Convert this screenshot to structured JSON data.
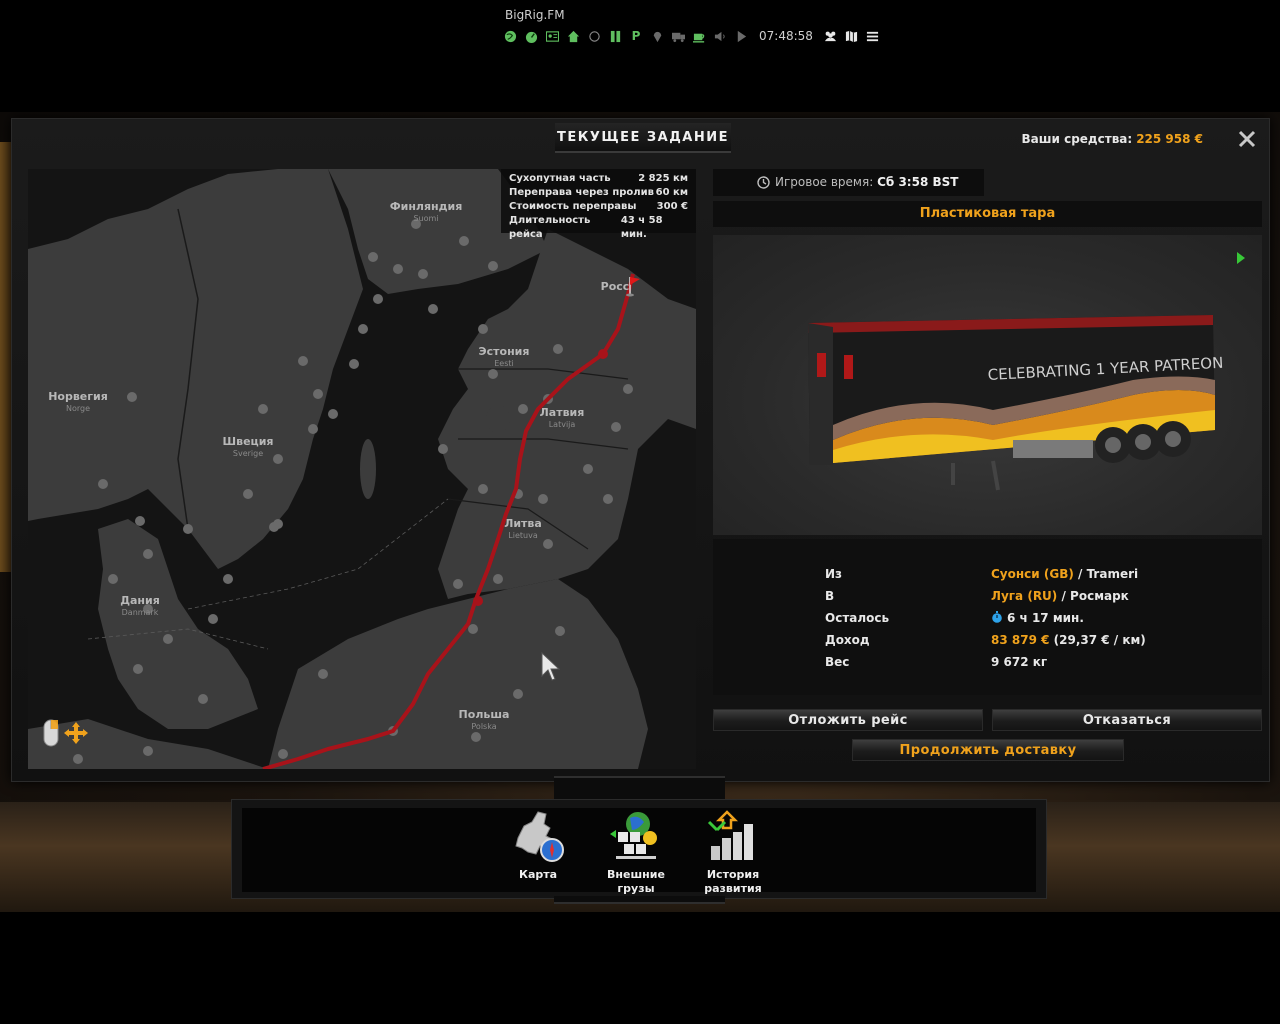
{
  "overlay": {
    "station": "BigRig.FM",
    "time": "07:48:58",
    "parking_label": "P",
    "icons": [
      "globe-icon",
      "speedometer-icon",
      "id-card-icon",
      "home-icon",
      "circle-icon",
      "pause-icon",
      "map-pin-icon",
      "truck-icon",
      "coffee-icon",
      "volume-icon",
      "play-icon",
      "group-icon",
      "map-icon",
      "menu-icon"
    ]
  },
  "window": {
    "title": "ТЕКУЩЕЕ ЗАДАНИЕ",
    "funds_label": "Ваши средства:",
    "funds_value": "225 958 €"
  },
  "route_stats": [
    {
      "label": "Сухопутная часть",
      "value": "2 825 км"
    },
    {
      "label": "Переправа через пролив",
      "value": "60 км"
    },
    {
      "label": "Стоимость переправы",
      "value": "300 €"
    },
    {
      "label": "Длительность рейса",
      "value": "43 ч 58 мин."
    }
  ],
  "map_labels": [
    {
      "ru": "Финляндия",
      "loc": "Suomi"
    },
    {
      "ru": "Росс",
      "loc": ""
    },
    {
      "ru": "Эстония",
      "loc": "Eesti"
    },
    {
      "ru": "Норвегия",
      "loc": "Norge"
    },
    {
      "ru": "Латвия",
      "loc": "Latvija"
    },
    {
      "ru": "Швеция",
      "loc": "Sverige"
    },
    {
      "ru": "Литва",
      "loc": "Lietuva"
    },
    {
      "ru": "Дания",
      "loc": "Danmark"
    },
    {
      "ru": "Польша",
      "loc": "Polska"
    }
  ],
  "job": {
    "game_time_label": "Игровое время:",
    "game_time_value": "Сб 3:58 BST",
    "cargo": "Пластиковая тара",
    "trailer_text": "CELEBRATING 1 YEAR PATREON",
    "from_label": "Из",
    "from_city": "Суонси (GB)",
    "from_company": " / Trameri",
    "to_label": "В",
    "to_city": "Луга (RU)",
    "to_company": " / Росмарк",
    "remaining_label": "Осталось",
    "remaining_value": "6 ч 17 мин.",
    "income_label": "Доход",
    "income_value": "83 879 €",
    "income_rate": " (29,37 € / км)",
    "weight_label": "Вес",
    "weight_value": "9 672 кг"
  },
  "buttons": {
    "postpone": "Отложить рейс",
    "cancel": "Отказаться",
    "continue": "Продолжить доставку"
  },
  "dock": [
    {
      "label": "Карта"
    },
    {
      "label": "Внешние грузы"
    },
    {
      "label": "История развития"
    }
  ]
}
